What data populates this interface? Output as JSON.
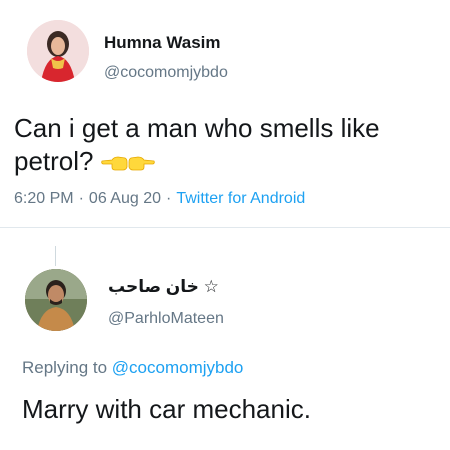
{
  "tweet": {
    "author_name": "Humna Wasim",
    "author_handle": "@cocomomjybdo",
    "text": "Can i get a man who smells like petrol?",
    "emojis": [
      "backhand-index-pointing-left-icon",
      "backhand-index-pointing-right-icon"
    ],
    "time": "6:20 PM",
    "separator": "·",
    "date": "06 Aug 20",
    "source": "Twitter for Android"
  },
  "reply": {
    "author_name": "☆ خان صاحب",
    "author_handle": "@ParhloMateen",
    "replying_prefix": "Replying to",
    "replying_to": "@cocomomjybdo",
    "text": "Marry with car mechanic."
  },
  "colors": {
    "primary_text": "#14171a",
    "secondary_text": "#657786",
    "link": "#1da1f2",
    "emoji": "#ffd83b",
    "divider": "#e1e8ed"
  }
}
